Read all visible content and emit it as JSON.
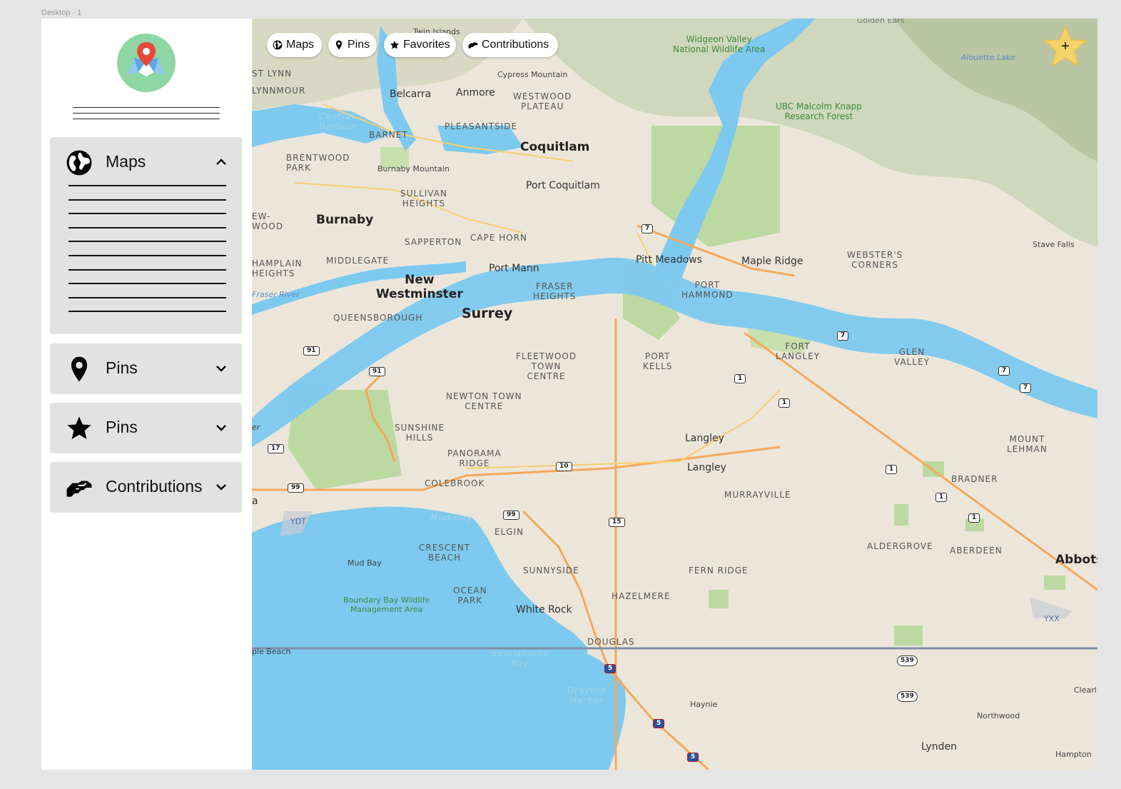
{
  "frame": {
    "label": "Desktop - 1"
  },
  "sidebar": {
    "panels": [
      {
        "label": "Maps",
        "icon": "globe-icon",
        "expanded": true
      },
      {
        "label": "Pins",
        "icon": "map-pin-icon",
        "expanded": false
      },
      {
        "label": "Pins",
        "icon": "star-icon",
        "expanded": false
      },
      {
        "label": "Contributions",
        "icon": "handshake-icon",
        "expanded": false
      }
    ]
  },
  "toolbar": {
    "chips": [
      {
        "label": "Maps",
        "icon": "globe-icon"
      },
      {
        "label": "Pins",
        "icon": "map-pin-icon"
      },
      {
        "label": "Favorites",
        "icon": "star-icon"
      },
      {
        "label": "Contributions",
        "icon": "handshake-icon"
      }
    ],
    "add_favorite_label": "+"
  },
  "map": {
    "labels": {
      "twin_islands": "Twin Islands",
      "golden_ears": "Golden Ears",
      "widgeon": "Widgeon Valley\nNational Wildlife Area",
      "alouette": "Alouette Lake",
      "cypress": "Cypress Mountain",
      "st_lynn": "ST LYNN",
      "lynnmour": "LYNNMOUR",
      "belcarra": "Belcarra",
      "anmore": "Anmore",
      "westwood": "WESTWOOD\nPLATEAU",
      "ubc": "UBC Malcolm Knapp\nResearch Forest",
      "central": "Central\nHarbour",
      "barnet": "BARNET",
      "pleasantside": "PLEASANTSIDE",
      "coquitlam": "Coquitlam",
      "brentwood": "BRENTWOOD\nPARK",
      "burnaby_mtn": "Burnaby Mountain",
      "port_coquitlam": "Port Coquitlam",
      "sullivan": "SULLIVAN\nHEIGHTS",
      "burnaby": "Burnaby",
      "ewwood": "EW-\nWOOD",
      "cape_horn": "CAPE HORN",
      "sapperton": "SAPPERTON",
      "pitt": "Pitt Meadows",
      "maple": "Maple Ridge",
      "websters": "WEBSTER'S\nCORNERS",
      "stave": "Stave Falls",
      "champlain": "HAMPLAIN\nHEIGHTS",
      "middlegate": "MIDDLEGATE",
      "new_west": "New\nWestminster",
      "port_mann": "Port Mann",
      "fraser_heights": "FRASER\nHEIGHTS",
      "port_hammond": "PORT\nHAMMOND",
      "fraser_river": "Fraser River",
      "queensborough": "QUEENSBOROUGH",
      "surrey": "Surrey",
      "fort_langley": "FORT\nLANGLEY",
      "glen_valley": "GLEN\nVALLEY",
      "fleetwood": "FLEETWOOD\nTOWN\nCENTRE",
      "port_kells": "PORT\nKELLS",
      "newton": "NEWTON TOWN\nCENTRE",
      "sunshine": "SUNSHINE\nHILLS",
      "langley1": "Langley",
      "mount_lehman": "MOUNT\nLEHMAN",
      "panorama": "PANORAMA\nRIDGE",
      "langley2": "Langley",
      "bradner": "BRADNER",
      "colebrook": "COLEBROOK",
      "murrayville": "MURRAYVILLE",
      "yvr": "YDT",
      "mud_bay_water": "Mud Bay",
      "elgin": "ELGIN",
      "crescent": "CRESCENT\nBEACH",
      "aldergrove": "ALDERGROVE",
      "aberdeen": "ABERDEEN",
      "abbots": "Abbots",
      "mud_bay": "Mud Bay",
      "sunnyside": "SUNNYSIDE",
      "fern_ridge": "FERN RIDGE",
      "boundary": "Boundary Bay Wildlife\nManagement Area",
      "ocean_park": "OCEAN\nPARK",
      "hazelmere": "HAZELMERE",
      "white_rock": "White Rock",
      "yxx": "YXX",
      "douglas": "DOUGLAS",
      "maple_beach": "ple Beach",
      "semiahmoo": "Semiahmoo\nBay",
      "drayton": "Drayton\nHarbor",
      "haynie": "Haynie",
      "clearl": "Clearl",
      "northwood": "Northwood",
      "lynden": "Lynden",
      "hampton": "Hampton",
      "er": "er",
      "a": "a"
    },
    "shields": {
      "h7a": "7",
      "h7b": "7",
      "h7c": "7",
      "h7d": "7",
      "h91a": "91",
      "h91b": "91",
      "h1a": "1",
      "h1b": "1",
      "h1c": "1",
      "h1d": "1",
      "h1e": "1",
      "h17": "17",
      "h10": "10",
      "h99a": "99",
      "h99b": "99",
      "h15": "15",
      "h539a": "539",
      "h539b": "539",
      "i5a": "5",
      "i5b": "5",
      "i5c": "5"
    }
  }
}
